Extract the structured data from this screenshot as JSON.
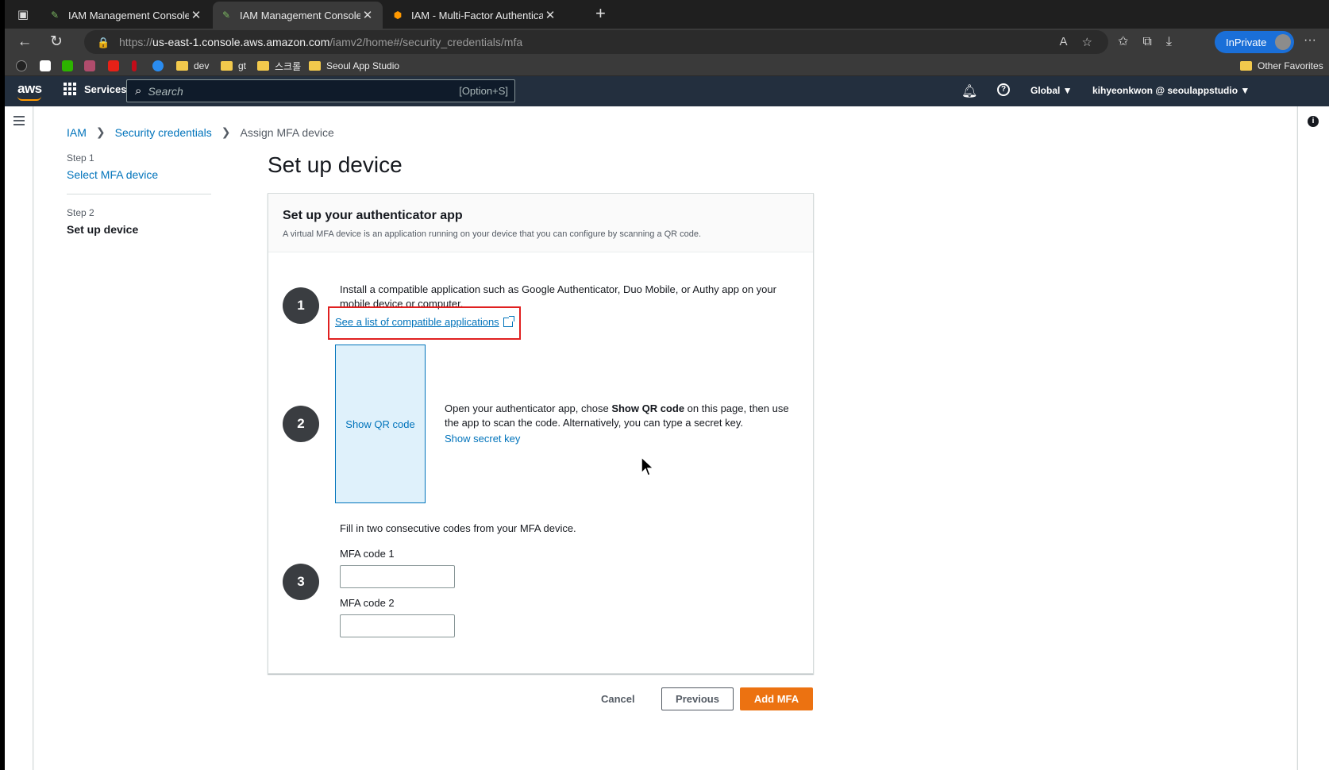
{
  "browser": {
    "tabs": [
      {
        "title": "IAM Management Console",
        "active": false
      },
      {
        "title": "IAM Management Console",
        "active": true
      },
      {
        "title": "IAM - Multi-Factor Authenticat",
        "active": false
      }
    ],
    "url_prefix": "https://",
    "url_host": "us-east-1.console.aws.amazon.com",
    "url_path": "/iamv2/home#/security_credentials/mfa",
    "inprivate_label": "InPrivate",
    "bookmarks": [
      {
        "label": "dev",
        "type": "folder"
      },
      {
        "label": "gt",
        "type": "folder"
      },
      {
        "label": "스크롤",
        "type": "folder"
      },
      {
        "label": "Seoul App Studio",
        "type": "folder"
      }
    ],
    "other_favorites": "Other Favorites"
  },
  "aws_nav": {
    "logo": "aws",
    "services_label": "Services",
    "search_placeholder": "Search",
    "search_shortcut": "[Option+S]",
    "region": "Global ▼",
    "account": "kihyeonkwon @ seoulappstudio ▼"
  },
  "breadcrumb": {
    "items": [
      "IAM",
      "Security credentials"
    ],
    "current": "Assign MFA device"
  },
  "steps": [
    {
      "label": "Step 1",
      "title": "Select MFA device"
    },
    {
      "label": "Step 2",
      "title": "Set up device"
    }
  ],
  "page_title": "Set up device",
  "panel": {
    "title": "Set up your authenticator app",
    "description": "A virtual MFA device is an application running on your device that you can configure by scanning a QR code.",
    "step1_number": "1",
    "step1_text": "Install a compatible application such as Google Authenticator, Duo Mobile, or Authy app on your mobile device or computer.",
    "step1_link": "See a list of compatible applications",
    "step2_number": "2",
    "qr_button": "Show QR code",
    "step2_text_a": "Open your authenticator app, chose ",
    "step2_text_bold": "Show QR code",
    "step2_text_b": " on this page, then use the app to scan the code. Alternatively, you can type a secret key.",
    "step2_link": "Show secret key",
    "step3_number": "3",
    "step3_text": "Fill in two consecutive codes from your MFA device.",
    "mfa_code1_label": "MFA code 1",
    "mfa_code1_value": "",
    "mfa_code2_label": "MFA code 2",
    "mfa_code2_value": ""
  },
  "actions": {
    "cancel": "Cancel",
    "previous": "Previous",
    "add_mfa": "Add MFA"
  },
  "colors": {
    "aws_nav_bg": "#232f3e",
    "link": "#0073bb",
    "primary_button": "#ec7211",
    "highlight_box": "#e02020"
  }
}
